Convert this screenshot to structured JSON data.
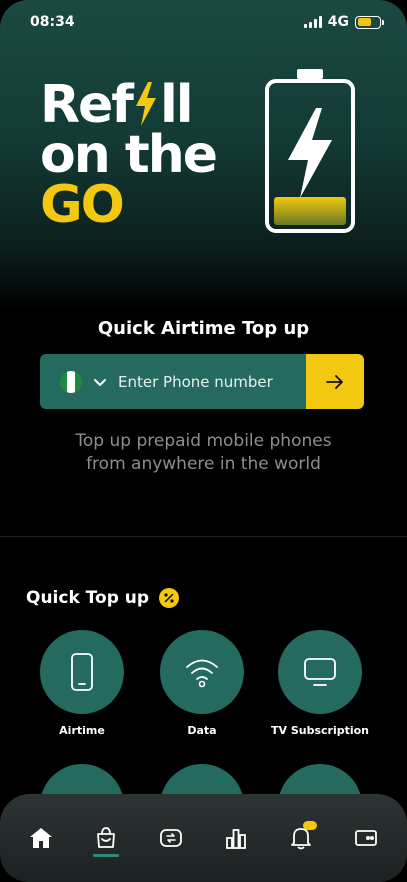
{
  "status_bar": {
    "time": "08:34",
    "network": "4G",
    "battery_level": 0.65
  },
  "hero": {
    "line1_a": "Ref",
    "line1_b": "ll",
    "line2": "on the",
    "line3": "GO",
    "battery_fill_level": 0.2
  },
  "quick_airtime": {
    "title": "Quick Airtime Top up",
    "phone_placeholder": "Enter Phone number",
    "country_flag": "nigeria-flag",
    "description": "Top up prepaid mobile phones from anywhere in the world"
  },
  "quick_topup": {
    "title": "Quick Top up",
    "services": [
      {
        "label": "Airtime",
        "icon": "phone-icon"
      },
      {
        "label": "Data",
        "icon": "wifi-icon"
      },
      {
        "label": "TV Subscription",
        "icon": "tv-icon"
      }
    ]
  },
  "bottom_nav": {
    "items": [
      "home-icon",
      "shopping-bag-icon",
      "exchange-icon",
      "chart-icon",
      "bell-icon",
      "wallet-icon"
    ],
    "active": "shopping-bag-icon",
    "notification_badge": ""
  },
  "colors": {
    "accent_yellow": "#f2c811",
    "teal": "#246a5e",
    "background": "#000000"
  }
}
